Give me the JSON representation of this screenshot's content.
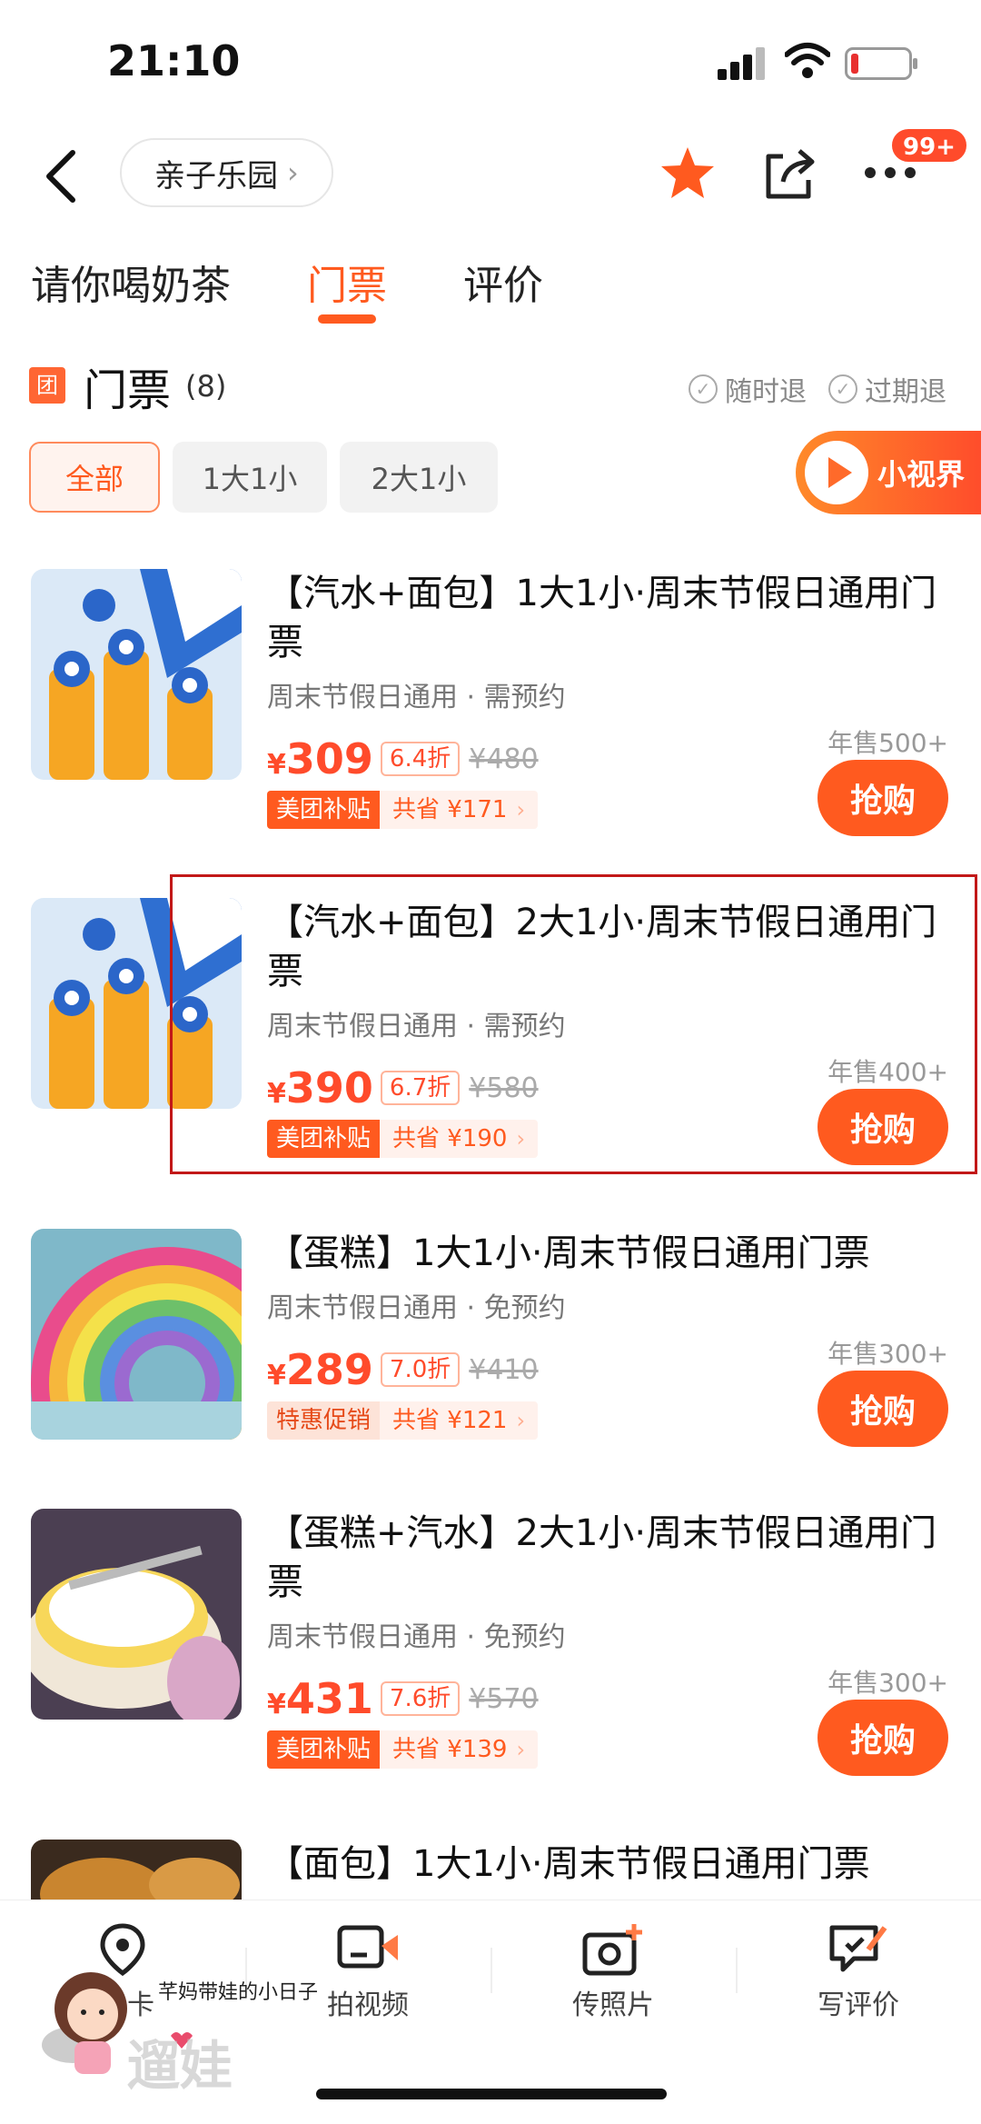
{
  "status_bar": {
    "time": "21:10"
  },
  "nav": {
    "breadcrumb": "亲子乐园",
    "badge": "99+"
  },
  "tabs": [
    {
      "label": "请你喝奶茶",
      "active": false
    },
    {
      "label": "门票",
      "active": true
    },
    {
      "label": "评价",
      "active": false
    }
  ],
  "section": {
    "icon_text": "团",
    "title": "门票",
    "count": "(8)",
    "policies": [
      "随时退",
      "过期退"
    ]
  },
  "filters": [
    {
      "label": "全部",
      "active": true
    },
    {
      "label": "1大1小",
      "active": false
    },
    {
      "label": "2大1小",
      "active": false
    }
  ],
  "video_badge": "小视界",
  "products": [
    {
      "title": "【汽水+面包】1大1小·周末节假日通用门票",
      "sub": "周末节假日通用 · 需预约",
      "yen": "¥",
      "price": "309",
      "discount": "6.4折",
      "orig": "¥480",
      "tag": "美团补贴",
      "save": "共省 ¥171",
      "sales": "年售500+",
      "button": "抢购",
      "image": "soda-bottles"
    },
    {
      "title": "【汽水+面包】2大1小·周末节假日通用门票",
      "sub": "周末节假日通用 · 需预约",
      "yen": "¥",
      "price": "390",
      "discount": "6.7折",
      "orig": "¥580",
      "tag": "美团补贴",
      "save": "共省 ¥190",
      "sales": "年售400+",
      "button": "抢购",
      "image": "soda-bottles"
    },
    {
      "title": "【蛋糕】1大1小·周末节假日通用门票",
      "sub": "周末节假日通用 · 免预约",
      "yen": "¥",
      "price": "289",
      "discount": "7.0折",
      "orig": "¥410",
      "tag": "特惠促销",
      "save": "共省 ¥121",
      "sales": "年售300+",
      "button": "抢购",
      "image": "rainbow-cake"
    },
    {
      "title": "【蛋糕+汽水】2大1小·周末节假日通用门票",
      "sub": "周末节假日通用 · 免预约",
      "yen": "¥",
      "price": "431",
      "discount": "7.6折",
      "orig": "¥570",
      "tag": "美团补贴",
      "save": "共省 ¥139",
      "sales": "年售300+",
      "button": "抢购",
      "image": "cream-cake"
    },
    {
      "title": "【面包】1大1小·周末节假日通用门票",
      "image": "bread"
    }
  ],
  "bottom_bar": [
    {
      "label": "卡",
      "icon": "location-pin-icon"
    },
    {
      "label": "拍视频",
      "icon": "video-icon"
    },
    {
      "label": "传照片",
      "icon": "camera-plus-icon"
    },
    {
      "label": "写评价",
      "icon": "review-icon"
    }
  ],
  "watermark": {
    "caption": "芊妈带娃的小日子",
    "logo_text": "遛娃"
  },
  "colors": {
    "accent": "#ff5a1f",
    "price": "#ff4b2b",
    "highlight": "#c21818"
  }
}
